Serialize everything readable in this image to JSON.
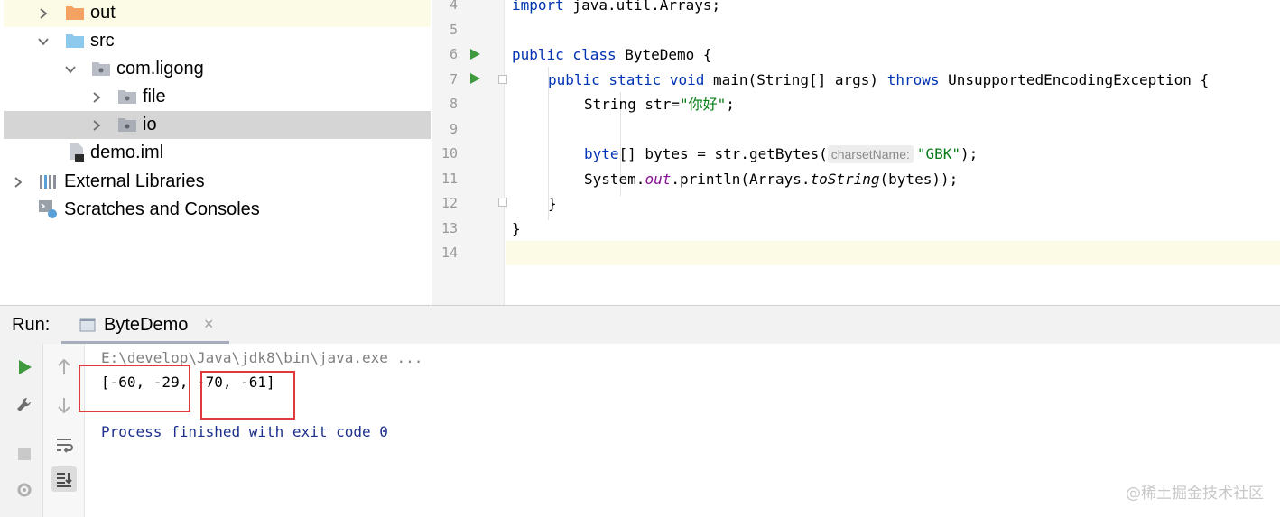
{
  "project_tree": {
    "items": [
      {
        "label": "out",
        "icon": "folder-orange-icon",
        "expanded": false
      },
      {
        "label": "src",
        "icon": "folder-blue-icon",
        "expanded": true
      },
      {
        "label": "com.ligong",
        "icon": "package-icon",
        "expanded": true
      },
      {
        "label": "file",
        "icon": "package-icon",
        "expanded": false
      },
      {
        "label": "io",
        "icon": "package-icon",
        "expanded": false,
        "selected": true
      },
      {
        "label": "demo.iml",
        "icon": "iml-file-icon"
      },
      {
        "label": "External Libraries",
        "icon": "libraries-icon",
        "expanded": false
      },
      {
        "label": "Scratches and Consoles",
        "icon": "scratches-icon"
      }
    ]
  },
  "editor": {
    "line_numbers": [
      "4",
      "5",
      "6",
      "7",
      "8",
      "9",
      "10",
      "11",
      "12",
      "13",
      "14"
    ],
    "code": {
      "l4_kw": "import",
      "l4_rest": " java.util.Arrays;",
      "l6_kw": "public class",
      "l6_rest": " ByteDemo {",
      "l7_kw1": "public static void",
      "l7_mid": " main(String[] args) ",
      "l7_kw2": "throws",
      "l7_rest": " UnsupportedEncodingException {",
      "l8_pre": "String str=",
      "l8_str": "\"你好\"",
      "l8_post": ";",
      "l10_kw": "byte",
      "l10_pre": "[] bytes = str.getBytes(",
      "l10_hint": "charsetName:",
      "l10_str": "\"GBK\"",
      "l10_post": ");",
      "l11_pre": "System.",
      "l11_out": "out",
      "l11_mid": ".println(Arrays.",
      "l11_it": "toString",
      "l11_post": "(bytes));",
      "l12": "}",
      "l13": "}"
    }
  },
  "run_panel": {
    "title": "Run:",
    "tab_label": "ByteDemo",
    "tab_close": "×",
    "console": {
      "command": "E:\\develop\\Java\\jdk8\\bin\\java.exe ...",
      "output": "[-60, -29, -70, -61]",
      "exit": "Process finished with exit code 0"
    }
  },
  "watermark": "@稀土掘金技术社区",
  "colors": {
    "keyword": "#0033b3",
    "string": "#067d17",
    "field": "#871094",
    "highlight_box": "#e0393e",
    "run_green": "#3f9a3f"
  }
}
